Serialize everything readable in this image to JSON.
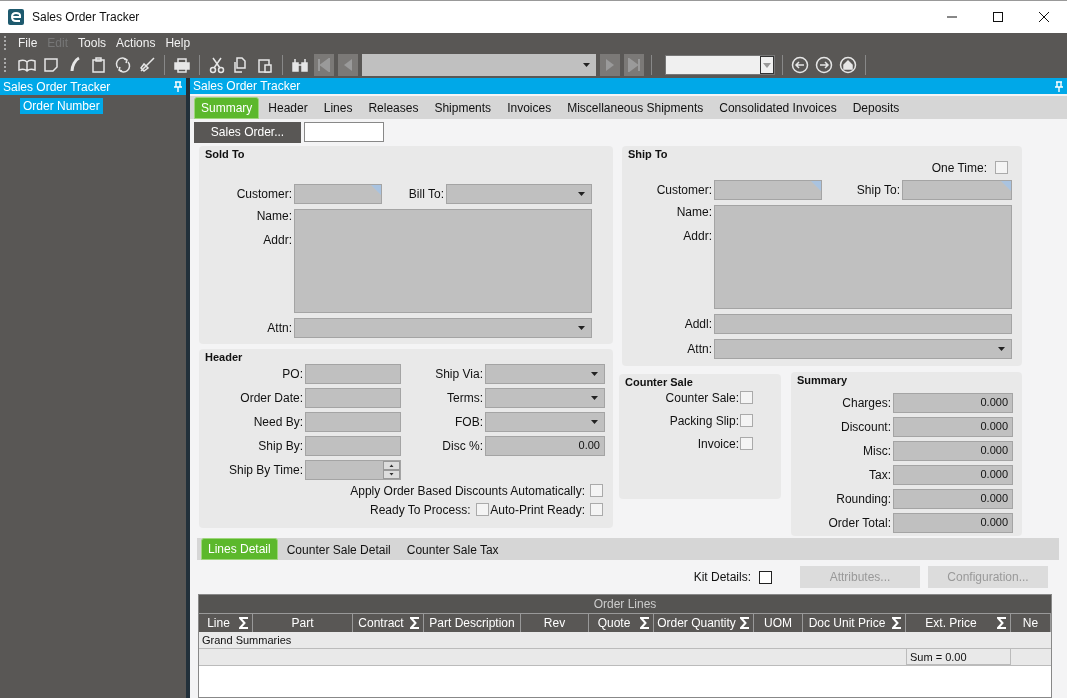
{
  "window": {
    "title": "Sales Order Tracker"
  },
  "menu": [
    {
      "label": "File",
      "disabled": false
    },
    {
      "label": "Edit",
      "disabled": true
    },
    {
      "label": "Tools",
      "disabled": false
    },
    {
      "label": "Actions",
      "disabled": false
    },
    {
      "label": "Help",
      "disabled": false
    }
  ],
  "tree_panel": {
    "title": "Sales Order Tracker",
    "items": [
      {
        "label": "Order Number",
        "selected": true
      }
    ]
  },
  "main_panel": {
    "title": "Sales Order Tracker"
  },
  "tabs": [
    {
      "label": "Summary",
      "selected": true
    },
    {
      "label": "Header",
      "selected": false
    },
    {
      "label": "Lines",
      "selected": false
    },
    {
      "label": "Releases",
      "selected": false
    },
    {
      "label": "Shipments",
      "selected": false
    },
    {
      "label": "Invoices",
      "selected": false
    },
    {
      "label": "Miscellaneous Shipments",
      "selected": false
    },
    {
      "label": "Consolidated Invoices",
      "selected": false
    },
    {
      "label": "Deposits",
      "selected": false
    }
  ],
  "sales_order": {
    "button": "Sales Order..."
  },
  "sold_to": {
    "title": "Sold To",
    "customer": "Customer:",
    "bill_to": "Bill To:",
    "name": "Name:",
    "addr": "Addr:",
    "attn": "Attn:"
  },
  "ship_to": {
    "title": "Ship To",
    "one_time": {
      "label": "One Time:",
      "checked": false
    },
    "customer": "Customer:",
    "ship_to": "Ship To:",
    "name": "Name:",
    "addr": "Addr:",
    "addl": "Addl:",
    "attn": "Attn:"
  },
  "header": {
    "title": "Header",
    "left_fields": [
      {
        "label": "PO:",
        "kind": "text"
      },
      {
        "label": "Order Date:",
        "kind": "text"
      },
      {
        "label": "Need By:",
        "kind": "text"
      },
      {
        "label": "Ship By:",
        "kind": "text"
      },
      {
        "label": "Ship By Time:",
        "kind": "spin"
      }
    ],
    "right_fields": [
      {
        "label": "Ship Via:",
        "kind": "combo"
      },
      {
        "label": "Terms:",
        "kind": "combo"
      },
      {
        "label": "FOB:",
        "kind": "combo"
      },
      {
        "label": "Disc %:",
        "kind": "number",
        "value": "0.00"
      }
    ],
    "apply_discounts": {
      "label": "Apply Order Based Discounts Automatically:",
      "checked": false
    },
    "ready_to_process": {
      "label": "Ready To Process:",
      "checked": false
    },
    "auto_print_ready": {
      "label": "Auto-Print Ready:",
      "checked": false
    }
  },
  "counter_sale": {
    "title": "Counter Sale",
    "options": [
      {
        "label": "Counter Sale:",
        "checked": false
      },
      {
        "label": "Packing Slip:",
        "checked": false
      },
      {
        "label": "Invoice:",
        "checked": false
      }
    ]
  },
  "summary": {
    "title": "Summary",
    "rows": [
      {
        "label": "Charges:",
        "value": "0.000"
      },
      {
        "label": "Discount:",
        "value": "0.000"
      },
      {
        "label": "Misc:",
        "value": "0.000"
      },
      {
        "label": "Tax:",
        "value": "0.000"
      },
      {
        "label": "Rounding:",
        "value": "0.000"
      },
      {
        "label": "Order Total:",
        "value": "0.000"
      }
    ]
  },
  "detail_tabs": [
    {
      "label": "Lines Detail",
      "selected": true
    },
    {
      "label": "Counter Sale Detail",
      "selected": false
    },
    {
      "label": "Counter Sale Tax",
      "selected": false
    }
  ],
  "kit_details": {
    "label": "Kit Details:",
    "checked": false
  },
  "buttons": [
    {
      "label": "Attributes...",
      "disabled": true
    },
    {
      "label": "Configuration...",
      "disabled": true
    }
  ],
  "order_lines": {
    "title": "Order Lines",
    "group_row": "Grand Summaries",
    "columns": [
      {
        "label": "Line",
        "summary": true
      },
      {
        "label": "Part",
        "summary": false
      },
      {
        "label": "Contract",
        "summary": true
      },
      {
        "label": "Part Description",
        "summary": false
      },
      {
        "label": "Rev",
        "summary": false
      },
      {
        "label": "Quote",
        "summary": true
      },
      {
        "label": "Order Quantity",
        "summary": true
      },
      {
        "label": "UOM",
        "summary": false
      },
      {
        "label": "Doc Unit Price",
        "summary": true
      },
      {
        "label": "Ext. Price",
        "summary": true,
        "sum": "Sum = 0.00"
      },
      {
        "label": "Ne",
        "summary": false
      }
    ]
  }
}
